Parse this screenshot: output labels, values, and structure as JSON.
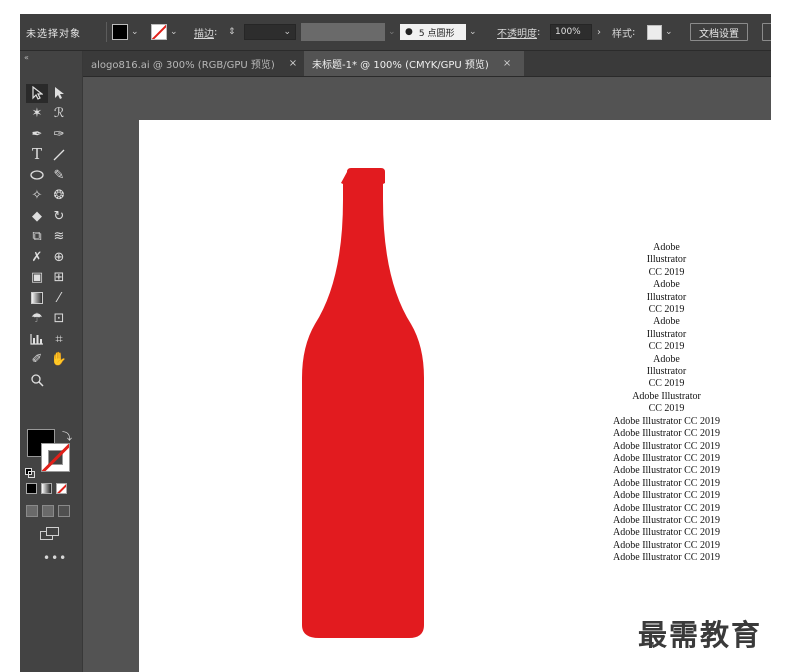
{
  "control_bar": {
    "selection_label": "未选择对象",
    "stroke_label": "描边",
    "brush_label": "5 点圆形",
    "opacity_label": "不透明度",
    "opacity_value": "100%",
    "style_label": "样式",
    "document_setup_label": "文档设置"
  },
  "tabs": [
    {
      "label": "alogo816.ai @ 300% (RGB/GPU 预览)",
      "close": "×"
    },
    {
      "label": "未标题-1* @ 100% (CMYK/GPU 预览)",
      "close": "×"
    }
  ],
  "tools": [
    [
      "selection-tool-icon",
      "direct-selection-tool-icon"
    ],
    [
      "magic-wand-tool-icon",
      "lasso-tool-icon"
    ],
    [
      "pen-tool-icon",
      "curvature-tool-icon"
    ],
    [
      "type-tool-icon",
      "line-segment-tool-icon"
    ],
    [
      "ellipse-tool-icon",
      "paintbrush-tool-icon"
    ],
    [
      "shaper-tool-icon",
      "blob-brush-tool-icon"
    ],
    [
      "eraser-tool-icon",
      "rotate-tool-icon"
    ],
    [
      "scale-tool-icon",
      "warp-tool-icon"
    ],
    [
      "puppet-warp-tool-icon",
      "shape-builder-tool-icon"
    ],
    [
      "perspective-grid-tool-icon",
      "mesh-tool-icon"
    ],
    [
      "gradient-tool-icon",
      "eyedropper-tool-icon"
    ],
    [
      "symbol-sprayer-tool-icon",
      "artboard-tool-icon"
    ],
    [
      "column-graph-tool-icon",
      "slice-tool-icon"
    ],
    [
      "pencil-tool-icon",
      "hand-tool-icon"
    ],
    [
      "zoom-tool-icon"
    ]
  ],
  "colors": {
    "bottle": "#e21b1f",
    "fill": "#000000",
    "stroke_none": "#e0201a",
    "app_bg": "#535353",
    "panel_bg": "#434343",
    "control_bg": "#3e3e3e"
  },
  "artboard_text": [
    "Adobe",
    "Illustrator",
    "CC 2019",
    "Adobe",
    "Illustrator",
    "CC 2019",
    "Adobe",
    "Illustrator",
    "CC 2019",
    "Adobe",
    "Illustrator",
    "CC 2019",
    "Adobe Illustrator",
    "CC 2019",
    "Adobe Illustrator CC 2019",
    "Adobe Illustrator CC 2019",
    "Adobe Illustrator CC 2019",
    "Adobe Illustrator CC 2019",
    "Adobe Illustrator CC 2019",
    "Adobe Illustrator CC 2019",
    "Adobe Illustrator CC 2019",
    "Adobe Illustrator CC 2019",
    "Adobe Illustrator CC 2019",
    "Adobe Illustrator CC 2019",
    "Adobe Illustrator CC 2019",
    "Adobe Illustrator CC 2019"
  ],
  "watermark": "最需教育",
  "more_tools": "•••"
}
